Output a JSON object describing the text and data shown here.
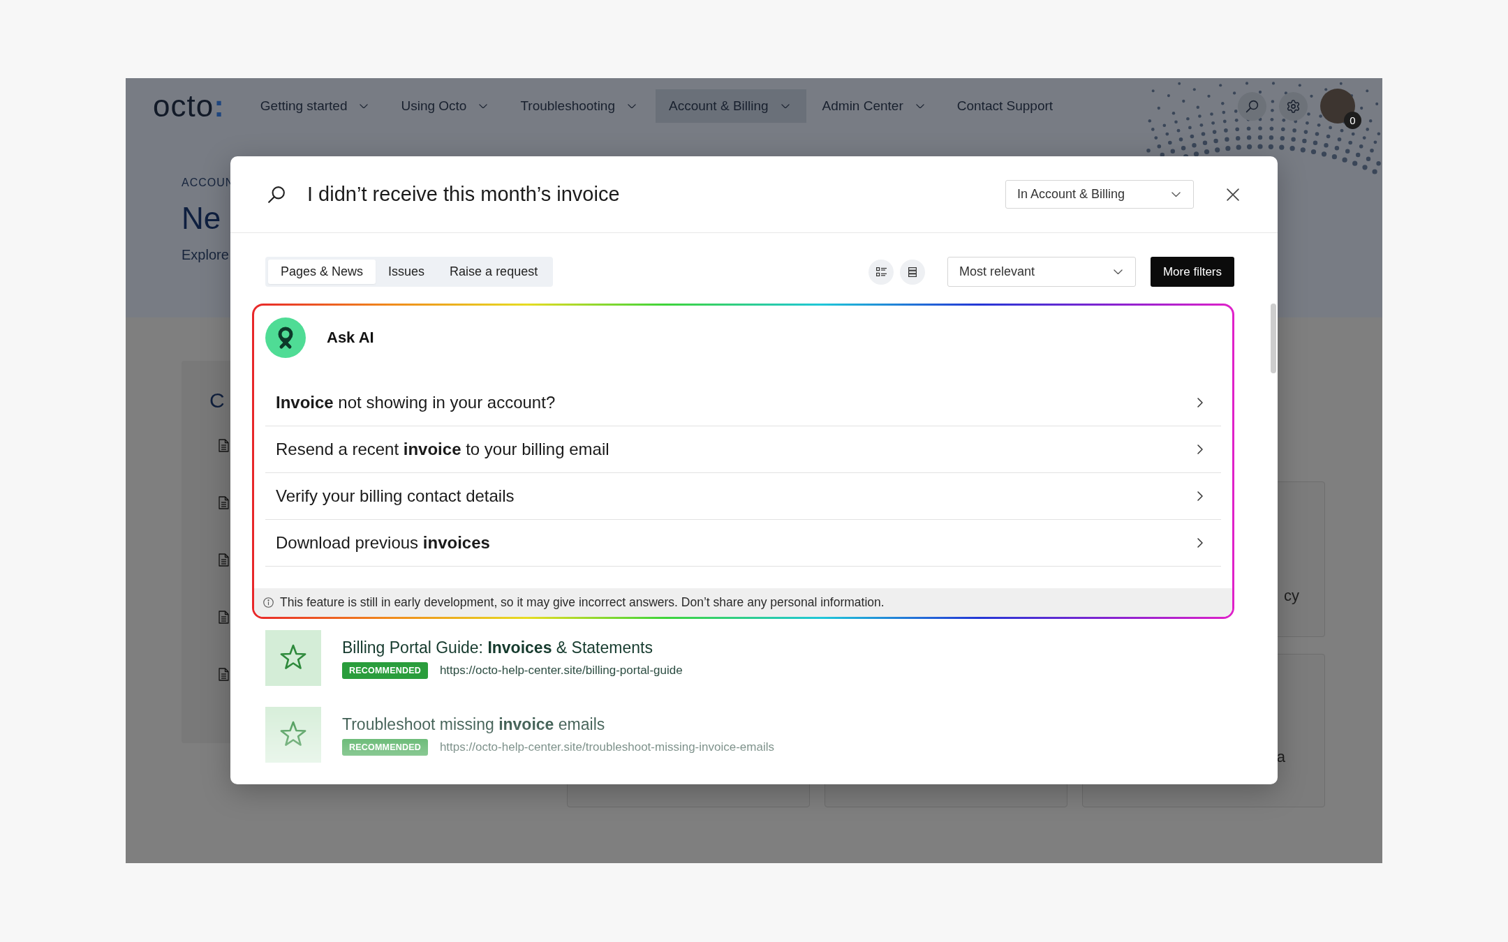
{
  "page": {
    "logo": {
      "word": "octo",
      "mark": ":"
    },
    "nav": [
      {
        "label": "Getting started",
        "has_menu": true,
        "selected": false
      },
      {
        "label": "Using Octo",
        "has_menu": true,
        "selected": false
      },
      {
        "label": "Troubleshooting",
        "has_menu": true,
        "selected": false
      },
      {
        "label": "Account & Billing",
        "has_menu": true,
        "selected": true
      },
      {
        "label": "Admin Center",
        "has_menu": true,
        "selected": false
      },
      {
        "label": "Contact Support",
        "has_menu": false,
        "selected": false
      }
    ],
    "user": {
      "badge": "0"
    },
    "header": {
      "eyebrow": "ACCOUN",
      "title": "Ne",
      "subtitle": "Explore"
    },
    "side_card": {
      "title": "C"
    },
    "cards": [
      {
        "text": "cy"
      },
      {
        "text": "a"
      }
    ]
  },
  "search_modal": {
    "query": "I didn’t receive this month’s invoice",
    "scope_select": {
      "value": "In Account & Billing"
    },
    "tabs": [
      {
        "label": "Pages & News",
        "selected": true
      },
      {
        "label": "Issues",
        "selected": false
      },
      {
        "label": "Raise a request",
        "selected": false
      }
    ],
    "sort_select": {
      "value": "Most relevant"
    },
    "more_filters_button": "More filters",
    "ask_ai": {
      "title": "Ask AI",
      "suggestions": [
        "**Invoice** not showing in your account?",
        "Resend a recent **invoice** to your billing email",
        "Verify your billing contact details",
        "Download previous **invoices**"
      ],
      "disclaimer": "This feature is still in early development, so it may give incorrect answers. Don’t share any personal information."
    },
    "results": [
      {
        "title": "Billing Portal Guide: **Invoices** & Statements",
        "badge": "RECOMMENDED",
        "url": "https://octo-help-center.site/billing-portal-guide"
      },
      {
        "title": "Troubleshoot missing **invoice** emails",
        "badge": "RECOMMENDED",
        "url": "https://octo-help-center.site/troubleshoot-missing-invoice-emails"
      }
    ]
  }
}
